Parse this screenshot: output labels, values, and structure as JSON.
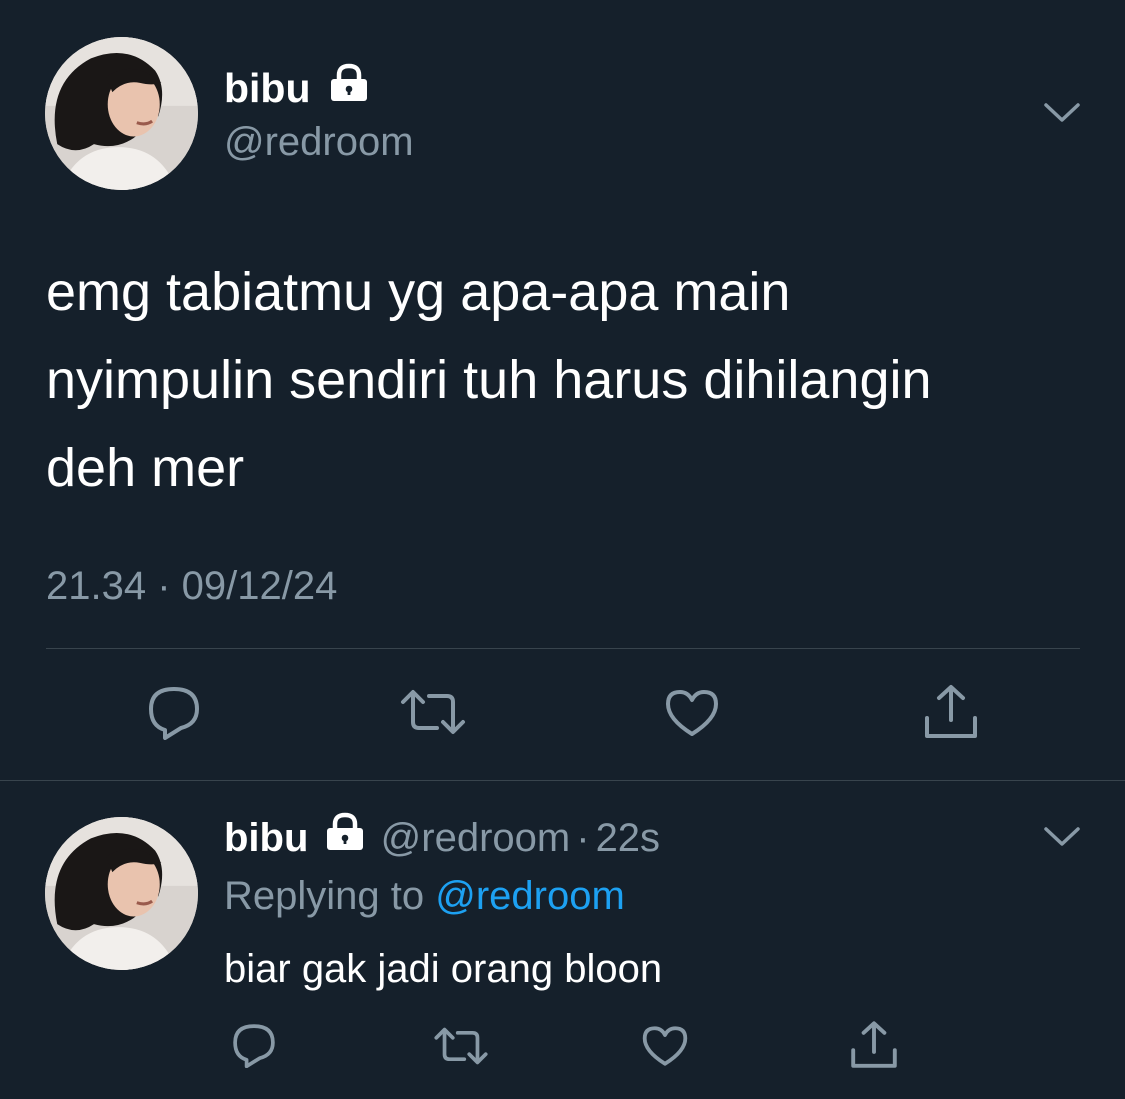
{
  "main_tweet": {
    "display_name": "bibu",
    "handle": "@redroom",
    "text_lines": [
      "emg tabiatmu yg apa-apa main",
      "nyimpulin sendiri tuh harus dihilangin",
      "deh mer"
    ],
    "timestamp": "21.34 · 09/12/24"
  },
  "reply_tweet": {
    "display_name": "bibu",
    "handle": "@redroom",
    "separator": "·",
    "age": "22s",
    "replying_prefix": "Replying to",
    "replying_to": "@redroom",
    "text": "biar gak jadi orang bloon"
  },
  "icons": {
    "lock": "lock-icon",
    "chevron": "chevron-down-icon",
    "reply": "reply-icon",
    "retweet": "retweet-icon",
    "like": "heart-icon",
    "share": "share-icon"
  },
  "colors": {
    "background": "#15202b",
    "text": "#ffffff",
    "muted": "#8899a6",
    "link": "#1da1f2",
    "divider": "#38444d"
  }
}
